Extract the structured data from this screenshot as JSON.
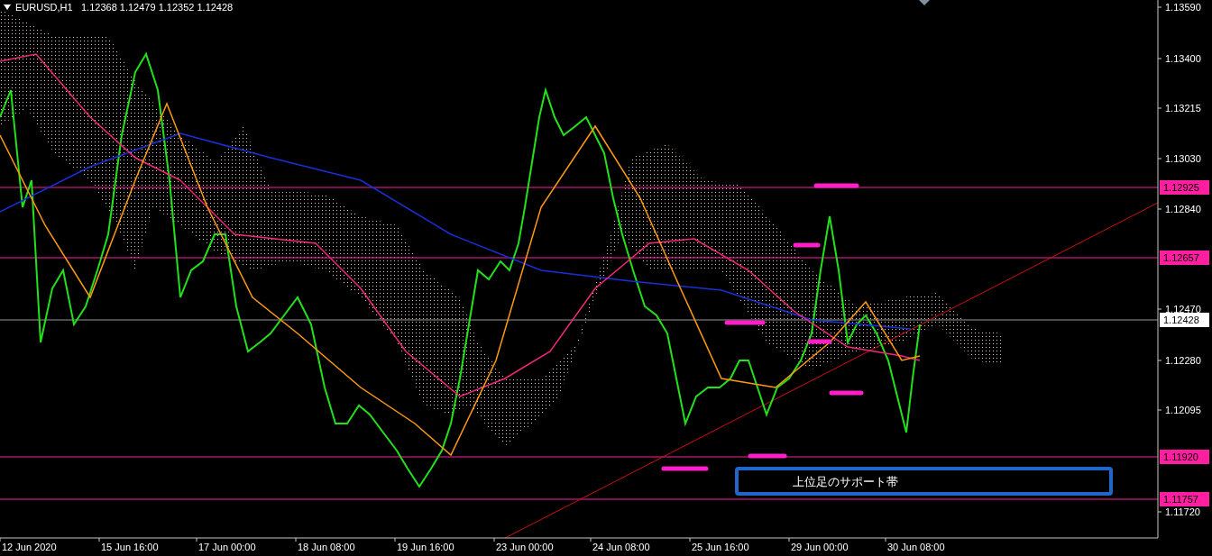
{
  "header": {
    "symbol": "EURUSD,H1",
    "ohlc": "1.12368 1.12479 1.12352 1.12428"
  },
  "price_axis": [
    "1.13590",
    "1.13400",
    "1.13215",
    "1.13030",
    "1.12840",
    "1.12470",
    "1.12280",
    "1.12095",
    "1.11720"
  ],
  "time_axis": [
    "12 Jun 2020",
    "15 Jun 16:00",
    "17 Jun 00:00",
    "18 Jun 08:00",
    "19 Jun 16:00",
    "23 Jun 00:00",
    "24 Jun 08:00",
    "25 Jun 16:00",
    "29 Jun 00:00",
    "30 Jun 08:00"
  ],
  "price_levels": [
    {
      "label": "1.12925",
      "color": "#ff1fa0"
    },
    {
      "label": "1.12657",
      "color": "#ff1fa0"
    },
    {
      "label": "1.12428",
      "color": "#ffffff"
    },
    {
      "label": "1.11920",
      "color": "#ff1fa0"
    },
    {
      "label": "1.11757",
      "color": "#ff1fa0"
    }
  ],
  "note": {
    "text": "上位足のサポート帯"
  }
}
